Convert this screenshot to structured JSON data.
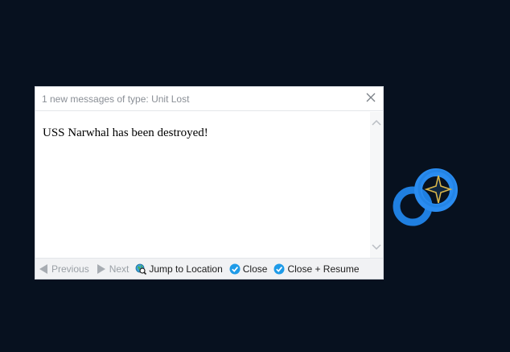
{
  "dialog": {
    "title": "1 new messages of type: Unit Lost",
    "message": "USS Narwhal has been destroyed!"
  },
  "toolbar": {
    "previous_label": "Previous",
    "next_label": "Next",
    "jump_label": "Jump to Location",
    "close_label": "Close",
    "close_resume_label": "Close + Resume"
  },
  "icons": {
    "close": "close-x-icon",
    "previous": "arrow-left-icon",
    "next": "arrow-right-icon",
    "jump": "globe-magnifier-icon",
    "close_button": "check-circle-icon",
    "close_resume_button": "check-circle-icon",
    "unit": "star-unit-marker-icon"
  },
  "colors": {
    "map_background": "#07111f",
    "check_blue": "#1e9be8",
    "unit_ring": "#1f7fe0",
    "unit_star": "#d8b54a"
  }
}
